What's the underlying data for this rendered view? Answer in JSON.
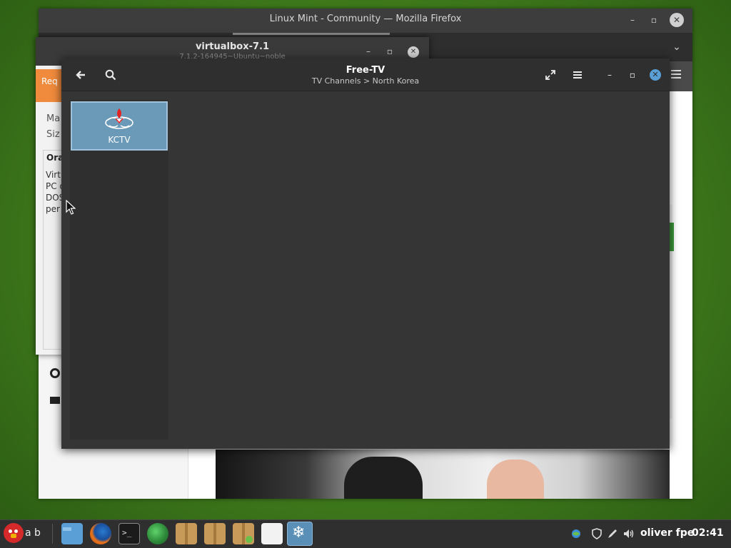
{
  "firefox": {
    "title": "Linux Mint - Community — Mozilla Firefox",
    "minimize": "–",
    "restore": "▫",
    "close": "✕",
    "menu": "⌄"
  },
  "vbox": {
    "title": "virtualbox-7.1",
    "subtitle": "7.1.2-164945~Ubuntu~noble",
    "accent_text": "Req",
    "labels": [
      "Ma",
      "Siz"
    ],
    "panel_heading": "Ora",
    "panel_lines": [
      "Virt",
      "PC d",
      "DOS",
      "per"
    ],
    "minimize": "–",
    "restore": "▫",
    "close": "✕"
  },
  "freetv": {
    "title": "Free-TV",
    "subtitle": "TV Channels > North Korea",
    "back_icon": "arrow-left-icon",
    "search_icon": "search-icon",
    "fullscreen_icon": "expand-icon",
    "menu_icon": "hamburger-icon",
    "minimize": "–",
    "restore": "▫",
    "close": "✕",
    "channels": [
      {
        "label": "KCTV",
        "logo": "kctv-logo"
      }
    ]
  },
  "taskbar": {
    "menu_label": "a b",
    "clock": "02:41",
    "user": "oliver fpe",
    "apps": [
      "angry-bird-menu-icon",
      "files-icon",
      "firefox-icon",
      "terminal-icon",
      "internet-download-manager-icon",
      "package-icon",
      "package-icon",
      "package-install-icon",
      "blank-window-icon",
      "snowflake-app-icon"
    ]
  },
  "colors": {
    "accent": "#5aa0d6",
    "tile": "#6a9ab8",
    "window_bg": "#353535"
  }
}
